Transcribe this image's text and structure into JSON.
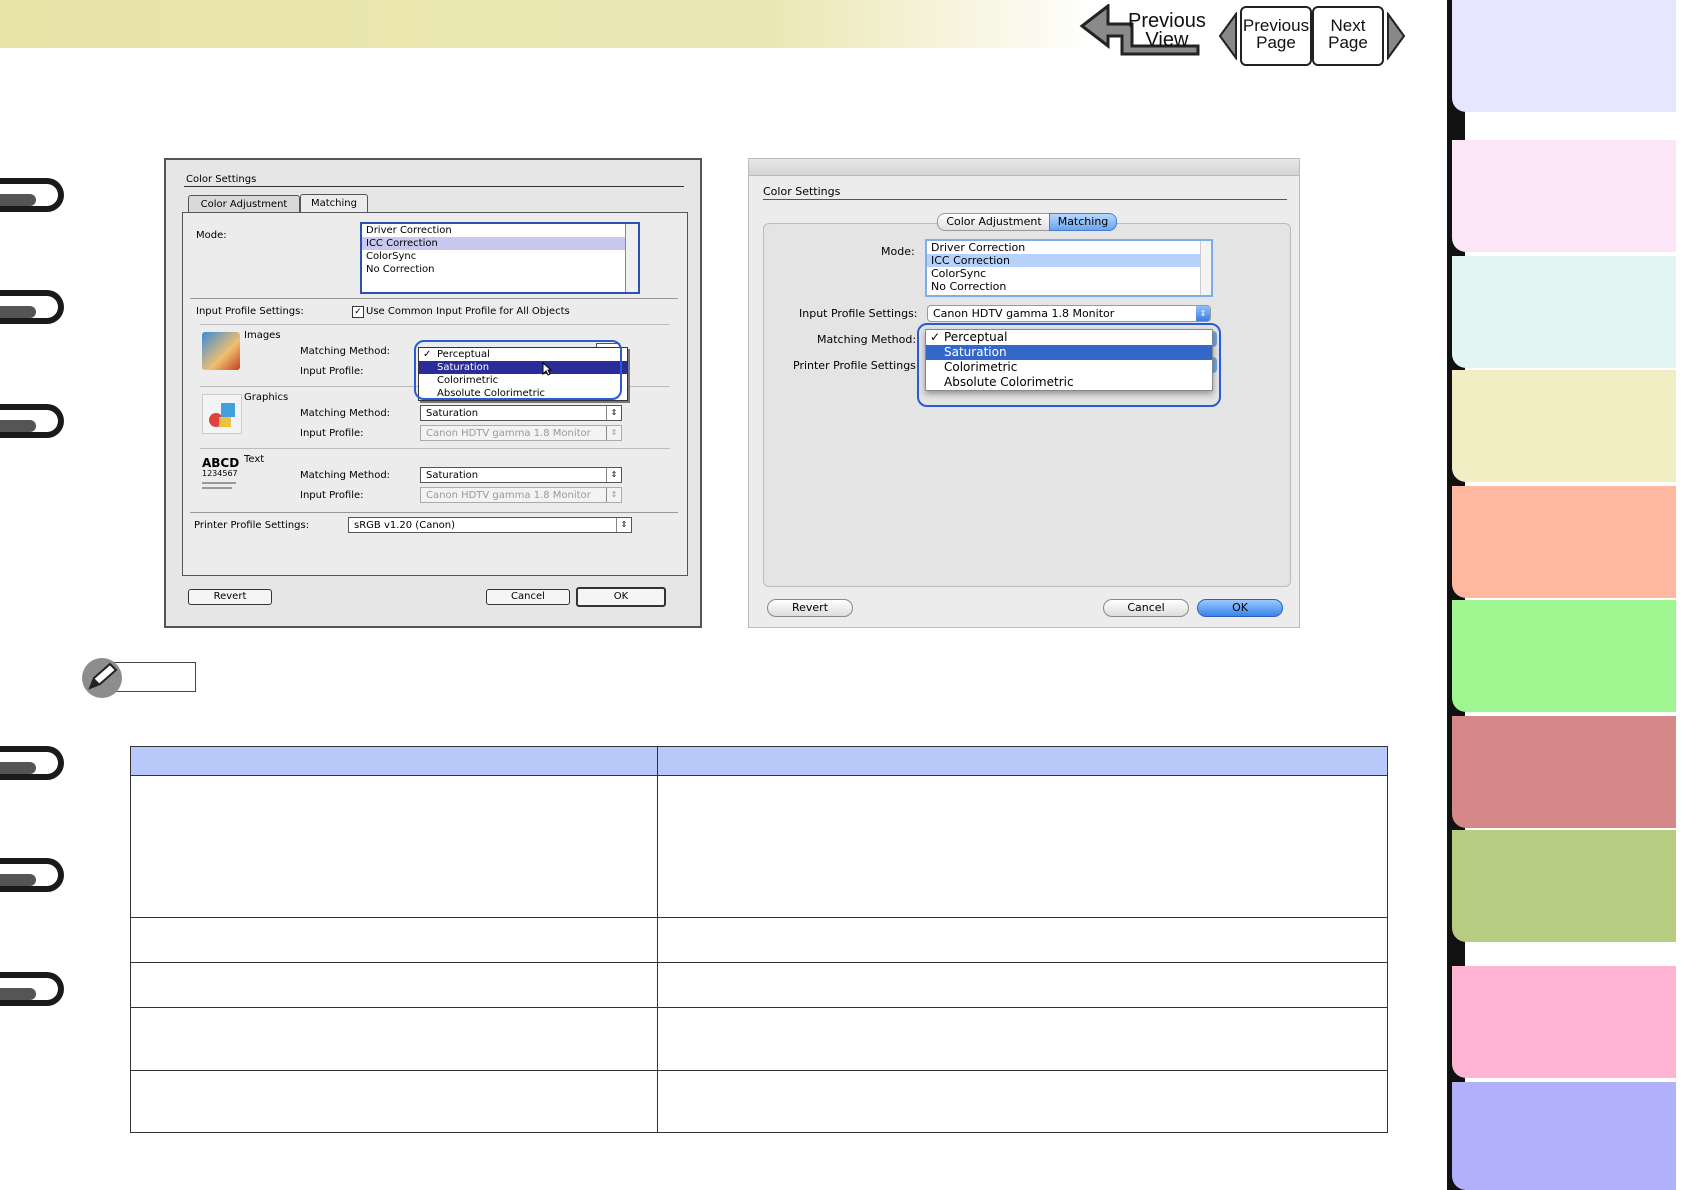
{
  "nav": {
    "previous_view_line1": "Previous",
    "previous_view_line2": "View",
    "previous_page_line1": "Previous",
    "previous_page_line2": "Page",
    "next_page_line1": "Next",
    "next_page_line2": "Page"
  },
  "side_tab_colors": [
    "#e6e6ff",
    "#fbe6f7",
    "#e2f5f2",
    "#f2eec4",
    "#fdb89f",
    "#a0f792",
    "#d48888",
    "#b6cd81",
    "#feb4d2",
    "#b0b0fb"
  ],
  "dialog_classic": {
    "title": "Color Settings",
    "tabs": [
      "Color Adjustment",
      "Matching"
    ],
    "mode_label": "Mode:",
    "mode_options": [
      "Driver Correction",
      "ICC Correction",
      "ColorSync",
      "No Correction"
    ],
    "mode_selected": "ICC Correction",
    "input_profile_settings_label": "Input Profile Settings:",
    "common_profile_checkbox": "Use Common Input Profile for All Objects",
    "images": {
      "label": "Images",
      "matching_method_label": "Matching Method:",
      "input_profile_label": "Input Profile:"
    },
    "graphics": {
      "label": "Graphics",
      "matching_method_label": "Matching Method:",
      "matching_method_value": "Saturation",
      "input_profile_label": "Input Profile:",
      "input_profile_value": "Canon HDTV gamma 1.8 Monitor"
    },
    "text": {
      "label": "Text",
      "icon_text": "ABCD",
      "icon_digits": "1234567",
      "matching_method_label": "Matching Method:",
      "matching_method_value": "Saturation",
      "input_profile_label": "Input Profile:",
      "input_profile_value": "Canon HDTV gamma 1.8 Monitor"
    },
    "printer_profile_label": "Printer Profile Settings:",
    "printer_profile_value": "sRGB v1.20 (Canon)",
    "menu_items": [
      "Perceptual",
      "Saturation",
      "Colorimetric",
      "Absolute Colorimetric"
    ],
    "menu_checked": "Perceptual",
    "menu_highlighted": "Saturation",
    "revert_label": "Revert",
    "cancel_label": "Cancel",
    "ok_label": "OK"
  },
  "dialog_aqua": {
    "title": "Color Settings",
    "tabs": [
      "Color Adjustment",
      "Matching"
    ],
    "mode_label": "Mode:",
    "mode_options": [
      "Driver Correction",
      "ICC Correction",
      "ColorSync",
      "No Correction"
    ],
    "mode_selected": "ICC Correction",
    "input_profile_label": "Input Profile Settings:",
    "input_profile_value": "Canon HDTV gamma 1.8 Monitor",
    "matching_method_label": "Matching Method:",
    "printer_profile_label": "Printer Profile Settings:",
    "menu_items": [
      "Perceptual",
      "Saturation",
      "Colorimetric",
      "Absolute Colorimetric"
    ],
    "menu_checked": "Perceptual",
    "menu_highlighted": "Saturation",
    "revert_label": "Revert",
    "cancel_label": "Cancel",
    "ok_label": "OK"
  },
  "table": {
    "rows": 5
  }
}
